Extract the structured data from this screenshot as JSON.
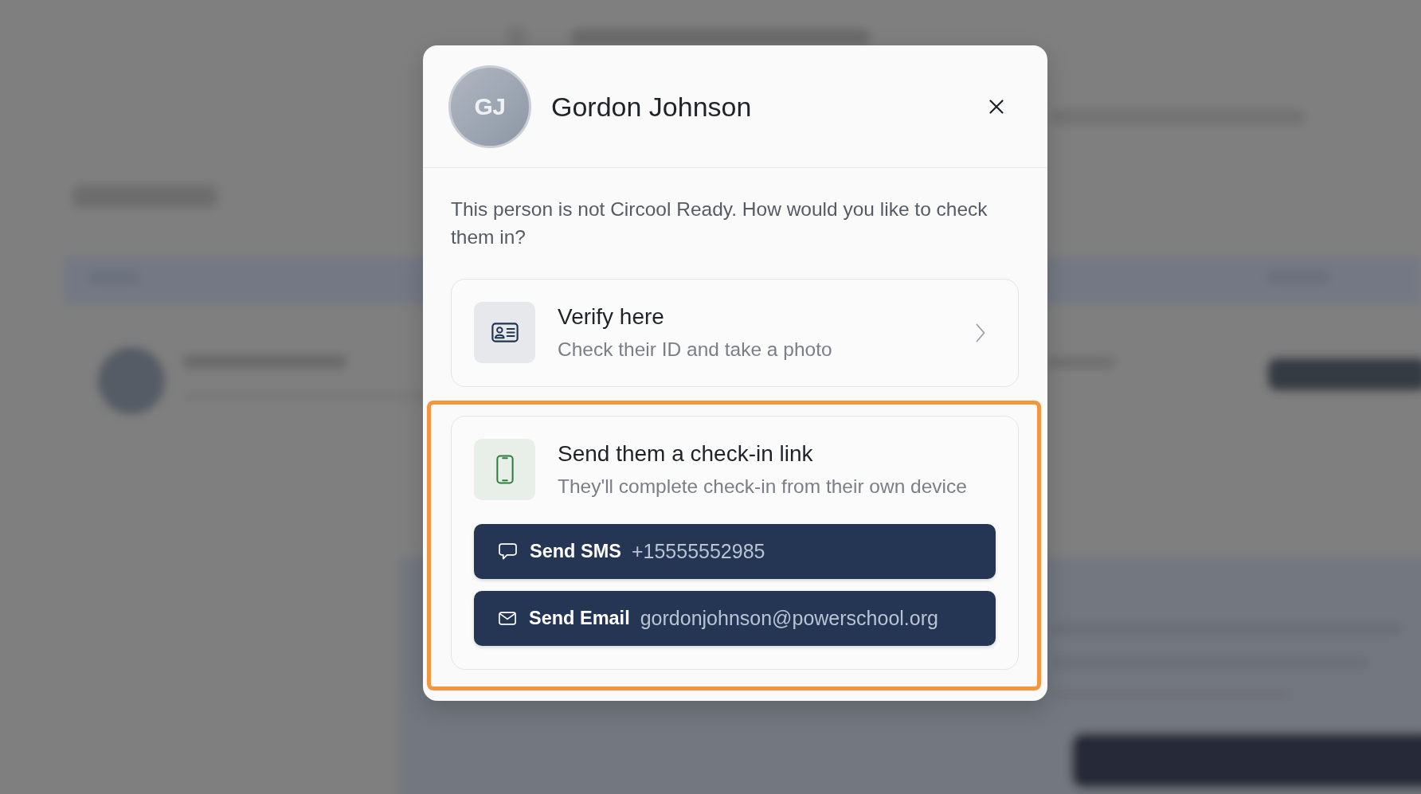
{
  "dialog": {
    "avatar": {
      "initials": "GJ"
    },
    "title": "Gordon Johnson",
    "message": "This person is not Circool Ready. How would you like to check them in?",
    "options": [
      {
        "kind": "verify",
        "title": "Verify here",
        "subtitle": "Check their ID and take a photo",
        "highlighted": false
      },
      {
        "kind": "send_link",
        "title": "Send them a check-in link",
        "subtitle": "They'll complete check-in from their own device",
        "highlighted": true,
        "actions": [
          {
            "kind": "sms",
            "label": "Send SMS",
            "value": "+15555552985"
          },
          {
            "kind": "email",
            "label": "Send Email",
            "value": "gordonjohnson@powerschool.org"
          }
        ]
      }
    ]
  }
}
